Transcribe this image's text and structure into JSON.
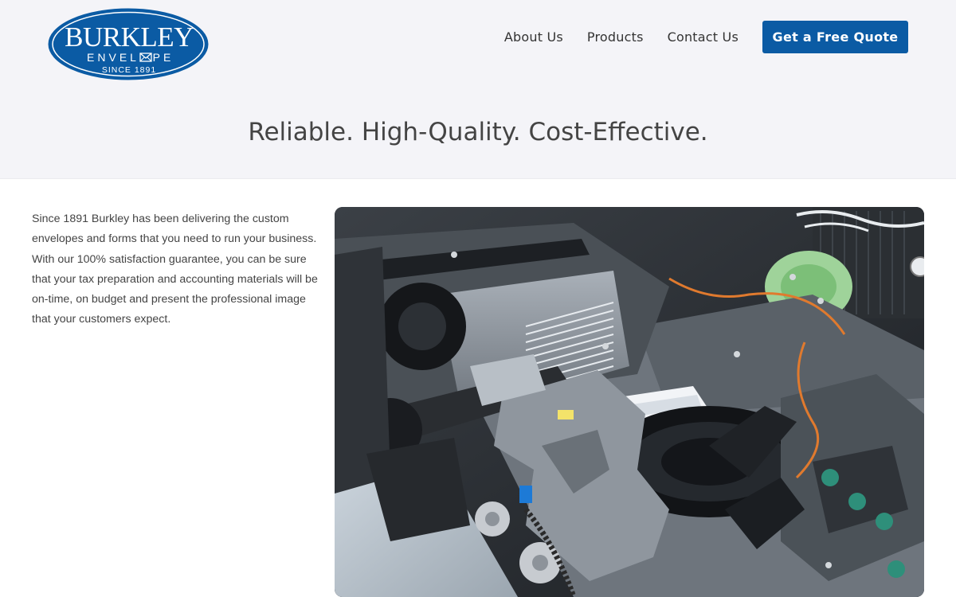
{
  "brand": {
    "name_line1": "BURKLEY",
    "name_line2": "ENVEL",
    "name_line2_end": "PE",
    "since": "SINCE 1891",
    "color": "#0b5ba4"
  },
  "nav": {
    "items": [
      {
        "label": "About Us"
      },
      {
        "label": "Products"
      },
      {
        "label": "Contact Us"
      }
    ],
    "cta_label": "Get a Free Quote"
  },
  "hero": {
    "tagline": "Reliable. High-Quality. Cost-Effective."
  },
  "intro": {
    "text": "Since 1891 Burkley has been delivering the custom envelopes and forms that you need to run your business. With our 100% satisfaction guarantee, you can be sure that your tax preparation and accounting materials will be on-time, on budget and present the professional image that your customers expect."
  },
  "photo": {
    "subject": "envelope-manufacturing-machine"
  }
}
